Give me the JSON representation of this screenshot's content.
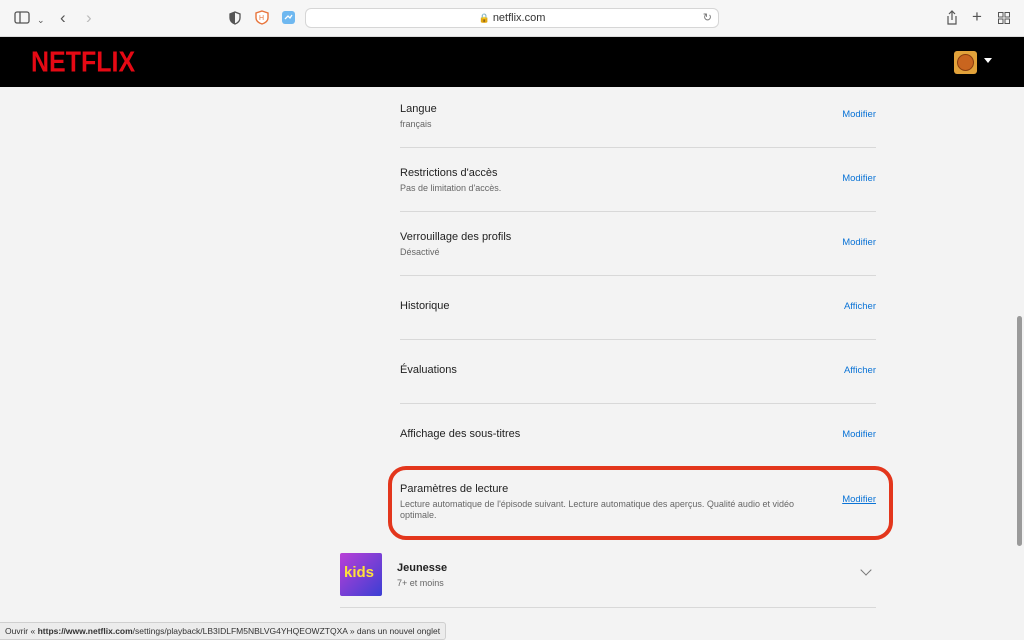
{
  "browser": {
    "url": "netflix.com",
    "status_prefix": "Ouvrir « ",
    "status_url_host": "https://www.netflix.com",
    "status_url_path": "/settings/playback/LB3IDLFM5NBLVG4YHQEOWZTQXA",
    "status_suffix": " » dans un nouvel onglet"
  },
  "header": {
    "logo": "NETFLIX"
  },
  "settings": [
    {
      "title": "Langue",
      "subtitle": "français",
      "action": "Modifier"
    },
    {
      "title": "Restrictions d'accès",
      "subtitle": "Pas de limitation d'accès.",
      "action": "Modifier"
    },
    {
      "title": "Verrouillage des profils",
      "subtitle": "Désactivé",
      "action": "Modifier"
    },
    {
      "title": "Historique",
      "action": "Afficher"
    },
    {
      "title": "Évaluations",
      "action": "Afficher"
    },
    {
      "title": "Affichage des sous-titres",
      "action": "Modifier"
    },
    {
      "title": "Paramètres de lecture",
      "subtitle": "Lecture automatique de l'épisode suivant. Lecture automatique des aperçus. Qualité audio et vidéo optimale.",
      "action": "Modifier"
    }
  ],
  "kids_profile": {
    "logo_text": "kids",
    "name": "Jeunesse",
    "age": "7+ et moins"
  },
  "colors": {
    "brand": "#e50914",
    "link": "#0a73d6",
    "highlight": "#e3361c"
  }
}
